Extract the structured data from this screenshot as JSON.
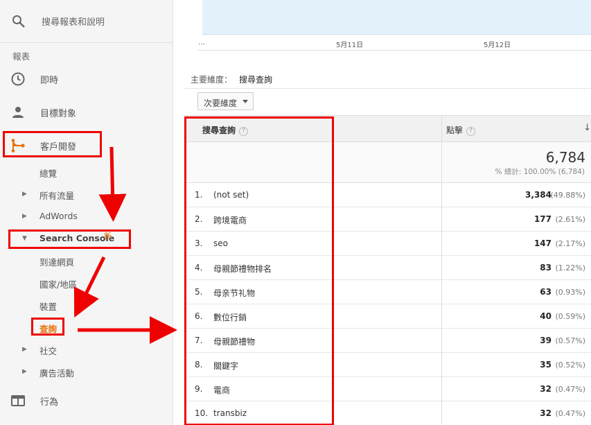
{
  "sidebar": {
    "search_label": "搜尋報表和說明",
    "section_label": "報表",
    "nav": [
      {
        "label": "即時",
        "icon": "clock-icon"
      },
      {
        "label": "目標對象",
        "icon": "person-icon"
      },
      {
        "label": "客戶開發",
        "icon": "acquisition-icon"
      }
    ],
    "sub_items": [
      {
        "label": "總覽"
      },
      {
        "label": "所有流量"
      },
      {
        "label": "AdWords"
      },
      {
        "label": "Search Console",
        "badge": "新"
      },
      {
        "label": "到達網頁"
      },
      {
        "label": "國家/地區"
      },
      {
        "label": "裝置"
      },
      {
        "label": "查詢"
      },
      {
        "label": "社交"
      },
      {
        "label": "廣告活動"
      }
    ],
    "behavior": {
      "label": "行為",
      "icon": "behavior-icon"
    }
  },
  "chart": {
    "ellipsis": "…",
    "ticks": [
      "5月11日",
      "5月12日"
    ]
  },
  "dimension": {
    "label": "主要維度：",
    "value": "搜尋查詢"
  },
  "secondary_button": "次要維度",
  "table": {
    "col_query": "搜尋查詢",
    "col_clicks": "點擊",
    "help_glyph": "?",
    "sort_glyph": "↓",
    "total": "6,784",
    "total_sub": "% 總計: 100.00% (6,784)",
    "rows": [
      {
        "n": "1.",
        "q": "(not set)",
        "c": "3,384",
        "p": "(49.88%)"
      },
      {
        "n": "2.",
        "q": "跨境電商",
        "c": "177",
        "p": "(2.61%)"
      },
      {
        "n": "3.",
        "q": "seo",
        "c": "147",
        "p": "(2.17%)"
      },
      {
        "n": "4.",
        "q": "母親節禮物排名",
        "c": "83",
        "p": "(1.22%)"
      },
      {
        "n": "5.",
        "q": "母亲节礼物",
        "c": "63",
        "p": "(0.93%)"
      },
      {
        "n": "6.",
        "q": "數位行銷",
        "c": "40",
        "p": "(0.59%)"
      },
      {
        "n": "7.",
        "q": "母親節禮物",
        "c": "39",
        "p": "(0.57%)"
      },
      {
        "n": "8.",
        "q": "關鍵字",
        "c": "35",
        "p": "(0.52%)"
      },
      {
        "n": "9.",
        "q": "電商",
        "c": "32",
        "p": "(0.47%)"
      },
      {
        "n": "10.",
        "q": "transbiz",
        "c": "32",
        "p": "(0.47%)"
      }
    ]
  },
  "colors": {
    "accent": "#e8710a",
    "annotation": "#e00000",
    "chart_fill": "#e3f2fa"
  }
}
